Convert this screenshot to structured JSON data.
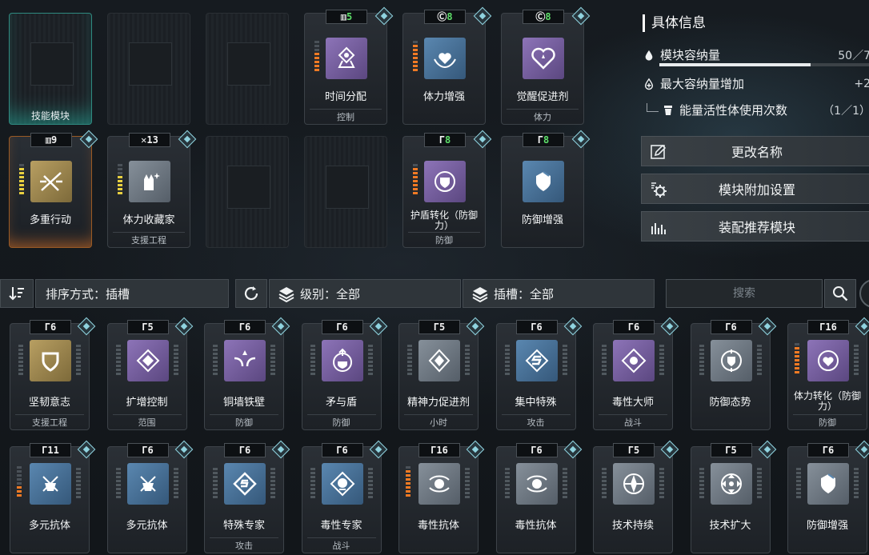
{
  "slots": [
    {
      "empty": true,
      "label": "技能模块",
      "glow": "teal"
    },
    {
      "empty": true
    },
    {
      "empty": true
    },
    {
      "cost_prefix": "▥",
      "cost": "5",
      "cost_color": "green",
      "name": "时间分配",
      "tag": "控制",
      "icon": "hourglass-icon",
      "color": "purple",
      "bars": 5,
      "bar_color": "orange"
    },
    {
      "cost_prefix": "Ⓒ",
      "cost": "8",
      "cost_color": "green",
      "name": "体力增强",
      "tag": "",
      "icon": "heart-hands-icon",
      "color": "blue",
      "bars": 7,
      "bar_color": "orange"
    },
    {
      "cost_prefix": "Ⓒ",
      "cost": "8",
      "cost_color": "green",
      "name": "觉醒促进剂",
      "tag": "体力",
      "icon": "heart-icon",
      "color": "purple",
      "bars": 0,
      "bar_color": "orange"
    },
    {
      "cost_prefix": "▥",
      "cost": "9",
      "cost_color": "white",
      "name": "多重行动",
      "tag": "",
      "icon": "chains-icon",
      "color": "gold",
      "bars": 7,
      "bar_color": "yellow",
      "glow": "orange"
    },
    {
      "cost_prefix": "✕",
      "cost": "13",
      "cost_color": "white",
      "name": "体力收藏家",
      "tag": "支援工程",
      "icon": "hand-sparkle-icon",
      "color": "grey",
      "bars": 5,
      "bar_color": "yellow"
    },
    {
      "empty": true
    },
    {
      "empty": true
    },
    {
      "cost_prefix": "Γ",
      "cost": "8",
      "cost_color": "green",
      "name": "护盾转化（防御力）",
      "tag": "防御",
      "icon": "shield-cycle-icon",
      "color": "purple",
      "bars": 7,
      "bar_color": "orange"
    },
    {
      "cost_prefix": "Γ",
      "cost": "8",
      "cost_color": "green",
      "name": "防御增强",
      "tag": "",
      "icon": "shield-up-icon",
      "color": "blue",
      "bars": 0,
      "bar_color": "orange"
    }
  ],
  "info": {
    "title": "具体信息",
    "capacity_label": "模块容纳量",
    "capacity_value": "50／7",
    "capacity_fraction": 0.72,
    "max_capacity_label": "最大容纳量增加",
    "max_capacity_value": "+2",
    "energy_label": "能量活性体使用次数",
    "energy_value": "（1／1）",
    "buttons": {
      "rename": "更改名称",
      "extra_settings": "模块附加设置",
      "recommend": "装配推荐模块"
    }
  },
  "filters": {
    "sort_label": "排序方式：插槽",
    "level_label": "级别：全部",
    "slot_label": "插槽：全部",
    "search_placeholder": "搜索"
  },
  "inventory": [
    {
      "cost": "6",
      "name": "坚韧意志",
      "tag": "支援工程",
      "icon": "shield-icon",
      "color": "gold"
    },
    {
      "cost": "5",
      "name": "扩增控制",
      "tag": "范围",
      "icon": "diamond-dots-icon",
      "color": "purple"
    },
    {
      "cost": "6",
      "name": "铜墙铁壁",
      "tag": "防御",
      "icon": "fortress-icon",
      "color": "purple"
    },
    {
      "cost": "6",
      "name": "矛与盾",
      "tag": "防御",
      "icon": "spear-shield-icon",
      "color": "purple"
    },
    {
      "cost": "5",
      "name": "精神力促进剂",
      "tag": "小时",
      "icon": "spirit-diamond-icon",
      "color": "grey"
    },
    {
      "cost": "6",
      "name": "集中特殊",
      "tag": "攻击",
      "icon": "focus-s-icon",
      "color": "blue"
    },
    {
      "cost": "6",
      "name": "毒性大师",
      "tag": "战斗",
      "icon": "toxic-master-icon",
      "color": "purple"
    },
    {
      "cost": "6",
      "name": "防御态势",
      "tag": "",
      "icon": "defense-stance-icon",
      "color": "grey"
    },
    {
      "cost": "16",
      "name": "体力转化（防御力）",
      "tag": "防御",
      "icon": "stamina-convert-icon",
      "color": "purple",
      "bars": 7
    },
    {
      "cost": "11",
      "name": "多元抗体",
      "tag": "",
      "icon": "antibody-icon",
      "color": "blue",
      "bars": 3
    },
    {
      "cost": "6",
      "name": "多元抗体",
      "tag": "",
      "icon": "antibody-icon",
      "color": "blue"
    },
    {
      "cost": "6",
      "name": "特殊专家",
      "tag": "攻击",
      "icon": "special-expert-icon",
      "color": "blue"
    },
    {
      "cost": "6",
      "name": "毒性专家",
      "tag": "战斗",
      "icon": "toxic-expert-icon",
      "color": "blue"
    },
    {
      "cost": "16",
      "name": "毒性抗体",
      "tag": "",
      "icon": "toxic-antibody-icon",
      "color": "grey",
      "bars": 7
    },
    {
      "cost": "6",
      "name": "毒性抗体",
      "tag": "",
      "icon": "toxic-antibody-icon",
      "color": "grey"
    },
    {
      "cost": "5",
      "name": "技术持续",
      "tag": "",
      "icon": "tech-sustain-icon",
      "color": "grey"
    },
    {
      "cost": "5",
      "name": "技术扩大",
      "tag": "",
      "icon": "tech-expand-icon",
      "color": "grey"
    },
    {
      "cost": "6",
      "name": "防御增强",
      "tag": "",
      "icon": "shield-up-icon",
      "color": "grey"
    }
  ]
}
